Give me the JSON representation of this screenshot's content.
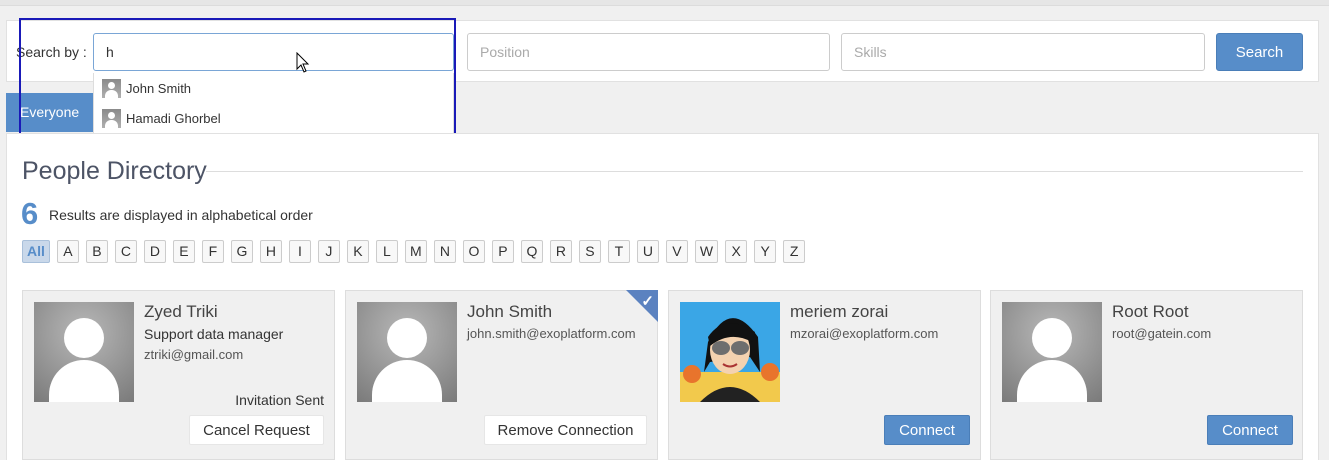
{
  "search": {
    "label": "Search by :",
    "name_value": "h",
    "position_placeholder": "Position",
    "skills_placeholder": "Skills",
    "button_label": "Search"
  },
  "suggestions": [
    {
      "name": "John Smith"
    },
    {
      "name": "Hamadi Ghorbel"
    }
  ],
  "tabs": {
    "everyone": "Everyone"
  },
  "directory": {
    "title": "People Directory",
    "count": "6",
    "count_text": "Results are displayed in alphabetical order"
  },
  "letters": [
    "All",
    "A",
    "B",
    "C",
    "D",
    "E",
    "F",
    "G",
    "H",
    "I",
    "J",
    "K",
    "L",
    "M",
    "N",
    "O",
    "P",
    "Q",
    "R",
    "S",
    "T",
    "U",
    "V",
    "W",
    "X",
    "Y",
    "Z"
  ],
  "active_letter": "All",
  "people": [
    {
      "name": "Zyed Triki",
      "position": "Support data manager",
      "email": "ztriki@gmail.com",
      "status": "Invitation Sent",
      "action": "Cancel Request"
    },
    {
      "name": "John Smith",
      "email": "john.smith@exoplatform.com",
      "action": "Remove Connection",
      "connected": true
    },
    {
      "name": "meriem zorai",
      "email": "mzorai@exoplatform.com",
      "action": "Connect"
    },
    {
      "name": "Root Root",
      "email": "root@gatein.com",
      "action": "Connect"
    }
  ],
  "colors": {
    "accent": "#578dc9",
    "focus_outline": "#1a1ab8"
  }
}
